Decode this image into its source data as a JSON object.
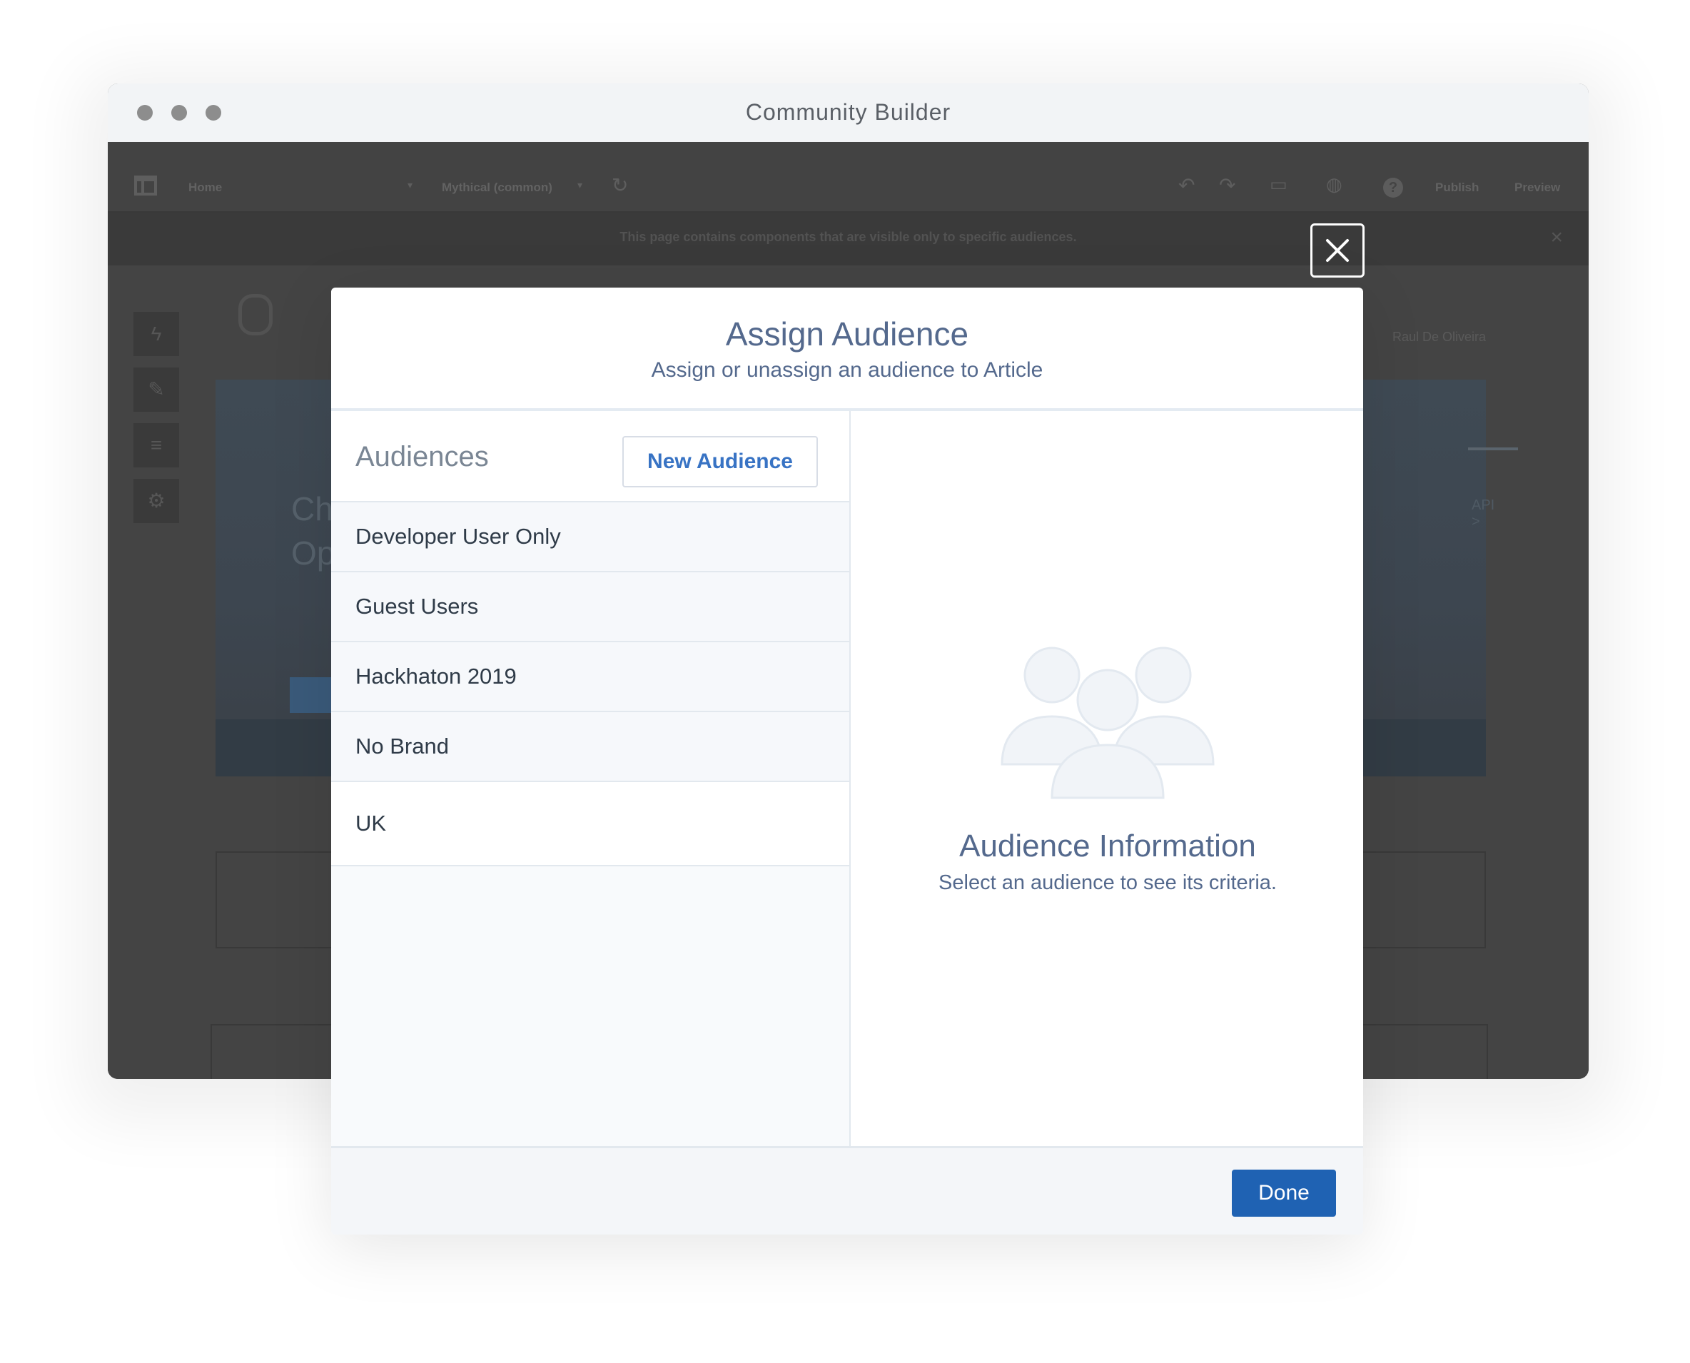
{
  "window": {
    "title": "Community Builder"
  },
  "toolbar": {
    "page_select": "Home",
    "theme_select": "Mythical (common)",
    "publish_label": "Publish",
    "preview_label": "Preview",
    "help_glyph": "?"
  },
  "banner": {
    "text": "This page contains components that are visible only to specific audiences."
  },
  "page": {
    "hero_text_line1": "Ch",
    "hero_text_line2": "Op",
    "user_name": "Raul De Oliveira",
    "hero_link": "API >"
  },
  "modal": {
    "title": "Assign Audience",
    "subtitle": "Assign or unassign an audience to Article",
    "list_title": "Audiences",
    "new_audience_label": "New Audience",
    "audiences": [
      {
        "label": "Developer User Only"
      },
      {
        "label": "Guest Users"
      },
      {
        "label": "Hackhaton 2019"
      },
      {
        "label": "No Brand"
      },
      {
        "label": "UK"
      }
    ],
    "info_title": "Audience Information",
    "info_text": "Select an audience to see its criteria.",
    "done_label": "Done"
  },
  "icons": {
    "close": "close-icon",
    "audience_illustration": "audience-group-icon",
    "undo": "undo-icon",
    "redo": "redo-icon"
  },
  "colors": {
    "accent": "#1f62b3",
    "link": "#3873c4",
    "heading": "#54698d"
  }
}
